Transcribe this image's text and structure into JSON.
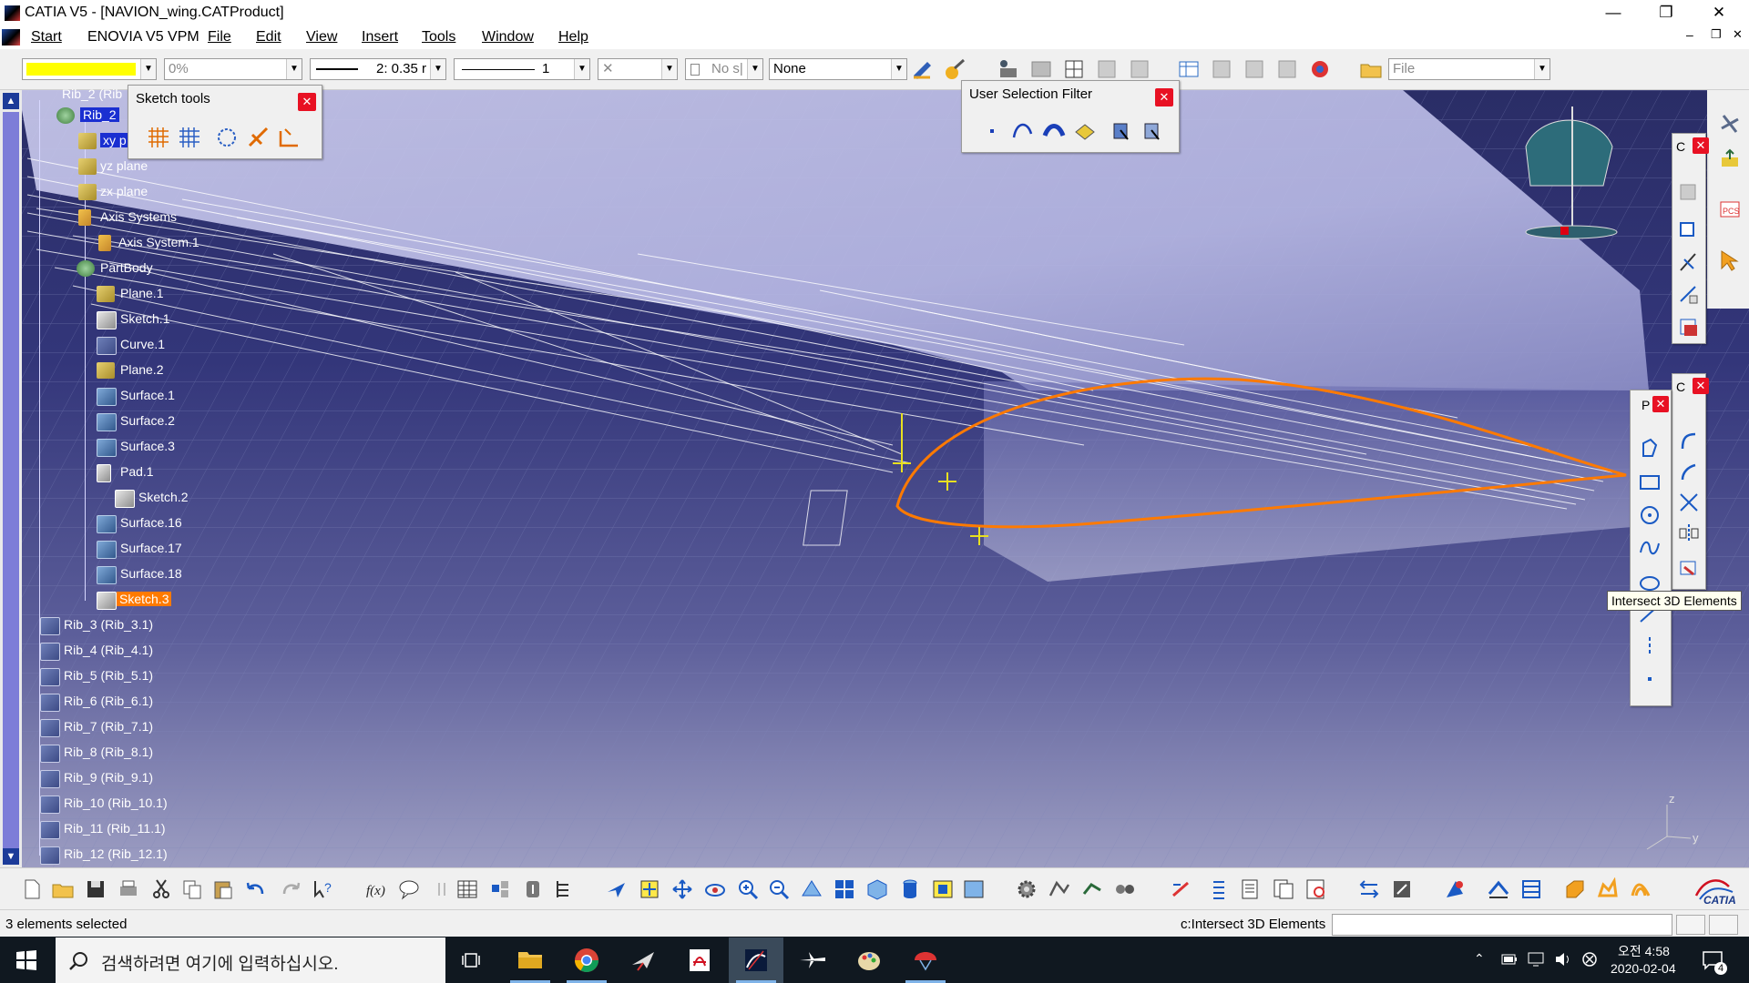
{
  "window": {
    "title": "CATIA V5 - [NAVION_wing.CATProduct]",
    "min": "—",
    "restore": "❐",
    "close": "✕",
    "doc_min": "–",
    "doc_restore": "❐",
    "doc_close": "✕"
  },
  "menu": {
    "start": "Start",
    "enovia": "ENOVIA V5 VPM",
    "file": "File",
    "edit": "Edit",
    "view": "View",
    "insert": "Insert",
    "tools": "Tools",
    "window": "Window",
    "help": "Help"
  },
  "toolbar": {
    "color_swatch": "#ffff00",
    "transparency": "0%",
    "line_thickness": "2: 0.35 r",
    "line_type": "1",
    "point_symbol": "✕",
    "layer_option": "No s|",
    "layer": "None",
    "file_field": "File"
  },
  "sketch_tools": {
    "title": "Sketch tools",
    "close": "✕"
  },
  "selection_filter": {
    "title": "User Selection Filter",
    "close": "✕"
  },
  "tree": {
    "rib2": "Rib_2 (Rib",
    "rib2_sel": "Rib_2",
    "xy": "xy p",
    "yz": "yz plane",
    "zx": "zx plane",
    "axis_systems": "Axis Systems",
    "axis_system1": "Axis System.1",
    "partbody": "PartBody",
    "plane1": "Plane.1",
    "sketch1": "Sketch.1",
    "curve1": "Curve.1",
    "plane2": "Plane.2",
    "surface1": "Surface.1",
    "surface2": "Surface.2",
    "surface3": "Surface.3",
    "pad1": "Pad.1",
    "sketch2": "Sketch.2",
    "surface16": "Surface.16",
    "surface17": "Surface.17",
    "surface18": "Surface.18",
    "sketch3": "Sketch.3",
    "rib3": "Rib_3 (Rib_3.1)",
    "rib4": "Rib_4 (Rib_4.1)",
    "rib5": "Rib_5 (Rib_5.1)",
    "rib6": "Rib_6 (Rib_6.1)",
    "rib7": "Rib_7 (Rib_7.1)",
    "rib8": "Rib_8 (Rib_8.1)",
    "rib9": "Rib_9 (Rib_9.1)",
    "rib10": "Rib_10 (Rib_10.1)",
    "rib11": "Rib_11 (Rib_11.1)",
    "rib12": "Rib_12 (Rib_12.1)"
  },
  "side_panels": {
    "c1": "C",
    "c2": "C",
    "p": "P",
    "close": "✕"
  },
  "tooltip": "Intersect 3D Elements",
  "compass_axes": {
    "z": "z",
    "y": "y"
  },
  "brand": "CATIA",
  "status": {
    "message": "3 elements selected",
    "command": "c:Intersect 3D Elements"
  },
  "taskbar": {
    "search_placeholder": "검색하려면 여기에 입력하십시오.",
    "time": "오전 4:58",
    "date": "2020-02-04",
    "notifications": "4"
  },
  "colors": {
    "selection_blue": "#1a2fd1",
    "highlight_orange": "#ff7a00",
    "viewport_top": "#2a2d66",
    "taskbar": "#101820"
  }
}
